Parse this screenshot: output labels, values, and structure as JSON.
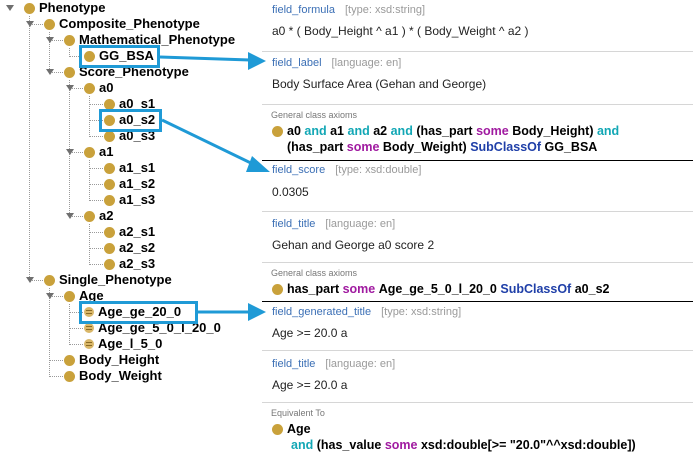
{
  "tree": {
    "phenotype": "Phenotype",
    "composite": "Composite_Phenotype",
    "mathematical": "Mathematical_Phenotype",
    "gg_bsa": "GG_BSA",
    "score": "Score_Phenotype",
    "a0": "a0",
    "a0_s1": "a0_s1",
    "a0_s2": "a0_s2",
    "a0_s3": "a0_s3",
    "a1": "a1",
    "a1_s1": "a1_s1",
    "a1_s2": "a1_s2",
    "a1_s3": "a1_s3",
    "a2": "a2",
    "a2_s1": "a2_s1",
    "a2_s2": "a2_s2",
    "a2_s3": "a2_s3",
    "single": "Single_Phenotype",
    "age": "Age",
    "age_ge_20": "Age_ge_20_0",
    "age_ge_5_l_20": "Age_ge_5_0_l_20_0",
    "age_l_5": "Age_l_5_0",
    "body_height": "Body_Height",
    "body_weight": "Body_Weight"
  },
  "panel": {
    "formula": {
      "name": "field_formula",
      "meta": "[type: xsd:string]",
      "value": "a0 * ( Body_Height ^ a1 ) * ( Body_Weight ^  a2 )"
    },
    "label": {
      "name": "field_label",
      "meta": "[language: en]",
      "value": "Body Surface Area (Gehan and George)"
    },
    "axioms1": {
      "header": "General class axioms",
      "a0": "a0",
      "and1": "and",
      "a1": "a1",
      "and2": "and",
      "a2": "a2",
      "and3": "and",
      "open": "(has_part",
      "some1": "some",
      "body_height": "Body_Height)",
      "and4": "and",
      "open2": "(has_part",
      "some2": "some",
      "body_weight": "Body_Weight)",
      "subclassof": "SubClassOf",
      "target": "GG_BSA"
    },
    "score": {
      "name": "field_score",
      "meta": "[type: xsd:double]",
      "value": "0.0305"
    },
    "title1": {
      "name": "field_title",
      "meta": "[language: en]",
      "value": "Gehan and George a0 score 2"
    },
    "axioms2": {
      "header": "General class axioms",
      "has_part": "has_part",
      "some": "some",
      "age_range": "Age_ge_5_0_l_20_0",
      "subclassof": "SubClassOf",
      "target": "a0_s2"
    },
    "generated_title": {
      "name": "field_generated_title",
      "meta": "[type: xsd:string]",
      "value": "Age >= 20.0 a"
    },
    "title2": {
      "name": "field_title",
      "meta": "[language: en]",
      "value": "Age >= 20.0 a"
    },
    "equivalent": {
      "header": "Equivalent To",
      "age": "Age",
      "and": "and",
      "open": "(has_value",
      "some": "some",
      "rest": "xsd:double[>= \"20.0\"^^xsd:double])"
    }
  },
  "colors": {
    "highlight": "#1f9ad6",
    "class_icon": "#c9a13b",
    "field_name": "#3b6fb5",
    "keyword_and": "#12a7b5",
    "keyword_some": "#a01aa0",
    "keyword_subclassof": "#1f3fa8"
  },
  "icons": {
    "class": "class-circle-icon",
    "individual": "individual-circle-icon",
    "caret": "caret-down-icon"
  }
}
